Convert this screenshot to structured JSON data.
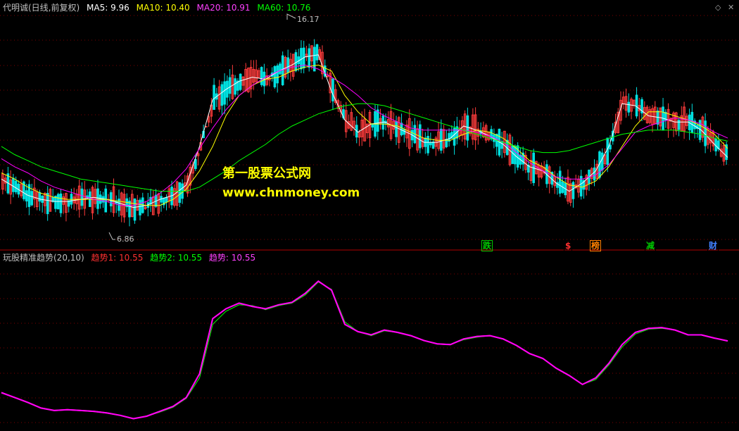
{
  "header": {
    "title": "代明诚(日线,前复权)",
    "ma5_label": "MA5: 9.96",
    "ma10_label": "MA10: 10.40",
    "ma20_label": "MA20: 10.91",
    "ma60_label": "MA60: 10.76",
    "icon": "diamond-icon"
  },
  "indicator_header": {
    "title": "玩股精准趋势(20,10)",
    "trend1_label": "趋势1: 10.55",
    "trend2_label": "趋势2: 10.55",
    "trend_label": "趋势: 10.55"
  },
  "watermark": {
    "line1": "第一股票公式网",
    "line2": "www.chnmoney.com"
  },
  "annotations": {
    "high": "16.17",
    "low": "6.86"
  },
  "events": [
    {
      "label": "跌",
      "color": "#00c800",
      "border": "#00c800"
    },
    {
      "label": "$",
      "color": "#ff3030",
      "border": "#000000"
    },
    {
      "label": "榜",
      "color": "#ff8000",
      "border": "#ff8000"
    },
    {
      "label": "减",
      "color": "#00c800",
      "border": "#000000"
    },
    {
      "label": "财",
      "color": "#4080ff",
      "border": "#000000"
    }
  ],
  "colors": {
    "up": "#ff3c3c",
    "down": "#00e0e0",
    "ma5": "#ffffff",
    "ma10": "#ffff00",
    "ma20": "#ff00ff",
    "ma60": "#00ff00",
    "trend1": "#ff3030",
    "trend2": "#00ff00",
    "trend": "#ff00ff",
    "grid": "#800000"
  },
  "chart_data": [
    {
      "type": "candlestick",
      "title": "代明诚(日线,前复权)",
      "price_range": [
        6.0,
        17.0
      ],
      "annotations": [
        {
          "label": "16.17",
          "value": 16.17
        },
        {
          "label": "6.86",
          "value": 6.86
        }
      ],
      "series": [
        {
          "name": "MA5",
          "values": [
            8.9,
            8.5,
            8.1,
            7.9,
            7.8,
            7.8,
            7.9,
            8.0,
            7.9,
            7.7,
            7.5,
            7.6,
            7.9,
            8.1,
            8.6,
            10.5,
            12.8,
            13.3,
            13.7,
            13.9,
            13.8,
            14.2,
            14.5,
            14.9,
            15.0,
            13.2,
            11.8,
            11.2,
            11.6,
            11.7,
            11.4,
            11.1,
            10.7,
            10.7,
            10.9,
            11.5,
            11.3,
            11.0,
            10.6,
            10.0,
            9.5,
            9.3,
            8.7,
            8.3,
            8.7,
            9.3,
            10.5,
            12.6,
            12.5,
            12.0,
            11.9,
            11.7,
            11.7,
            11.3,
            10.6,
            9.96
          ]
        },
        {
          "name": "MA10",
          "values": [
            9.2,
            8.9,
            8.5,
            8.2,
            8.0,
            7.9,
            7.9,
            7.9,
            7.9,
            7.8,
            7.7,
            7.6,
            7.6,
            7.9,
            8.4,
            9.3,
            10.5,
            12.0,
            13.0,
            13.5,
            13.8,
            13.9,
            14.2,
            14.4,
            14.5,
            14.2,
            13.0,
            12.2,
            11.6,
            11.6,
            11.5,
            11.2,
            10.9,
            10.8,
            10.8,
            11.1,
            11.3,
            11.2,
            10.9,
            10.4,
            9.8,
            9.5,
            9.0,
            8.6,
            8.5,
            8.8,
            9.5,
            10.5,
            11.5,
            12.2,
            12.2,
            12.0,
            11.8,
            11.5,
            11.1,
            10.4
          ]
        },
        {
          "name": "MA20",
          "values": [
            9.9,
            9.5,
            9.2,
            8.8,
            8.5,
            8.3,
            8.1,
            7.9,
            7.8,
            7.6,
            7.6,
            7.8,
            8.2,
            8.7,
            9.4,
            10.4,
            11.4,
            12.3,
            13.0,
            13.5,
            13.9,
            14.2,
            14.4,
            14.5,
            14.3,
            13.9,
            13.5,
            13.0,
            12.4,
            12.0,
            11.7,
            11.4,
            11.3,
            11.3,
            11.3,
            11.3,
            11.2,
            11.0,
            10.7,
            10.2,
            9.7,
            9.3,
            9.0,
            8.9,
            8.9,
            9.1,
            9.6,
            10.4,
            11.2,
            11.5,
            11.7,
            11.9,
            11.8,
            11.6,
            11.2,
            10.91
          ]
        },
        {
          "name": "MA60",
          "values": [
            10.5,
            10.1,
            9.8,
            9.5,
            9.3,
            9.1,
            8.9,
            8.8,
            8.7,
            8.6,
            8.5,
            8.4,
            8.3,
            8.3,
            8.3,
            8.5,
            8.9,
            9.3,
            9.8,
            10.2,
            10.6,
            11.1,
            11.5,
            11.8,
            12.1,
            12.3,
            12.5,
            12.6,
            12.6,
            12.5,
            12.3,
            12.1,
            11.9,
            11.7,
            11.5,
            11.3,
            11.1,
            10.9,
            10.7,
            10.5,
            10.3,
            10.2,
            10.2,
            10.3,
            10.5,
            10.7,
            10.9,
            11.1,
            11.2,
            11.3,
            11.3,
            11.3,
            11.2,
            11.1,
            10.9,
            10.76
          ]
        }
      ]
    },
    {
      "type": "line",
      "title": "玩股精准趋势(20,10)",
      "ylim": [
        0,
        20
      ],
      "series": [
        {
          "name": "趋势1",
          "values": [
            4.2,
            3.6,
            3.0,
            2.3,
            2.0,
            2.1,
            2.0,
            1.9,
            1.7,
            1.4,
            1.0,
            1.3,
            1.9,
            2.5,
            3.6,
            6.5,
            13.3,
            14.5,
            15.2,
            14.8,
            14.5,
            15.0,
            15.3,
            16.4,
            17.9,
            16.8,
            12.6,
            11.7,
            11.3,
            11.9,
            11.6,
            11.2,
            10.6,
            10.2,
            10.1,
            10.8,
            11.1,
            11.2,
            10.8,
            10.0,
            9.0,
            8.4,
            7.2,
            6.3,
            5.2,
            6.0,
            7.8,
            10.1,
            11.6,
            12.1,
            12.2,
            11.9,
            11.3,
            11.3,
            10.9,
            10.55
          ]
        },
        {
          "name": "趋势2",
          "values": [
            4.2,
            3.6,
            3.0,
            2.3,
            2.0,
            2.1,
            2.0,
            1.9,
            1.7,
            1.4,
            1.0,
            1.3,
            1.8,
            2.4,
            3.5,
            6.0,
            12.6,
            14.2,
            15.0,
            14.9,
            14.4,
            14.9,
            15.2,
            16.2,
            17.8,
            16.9,
            12.9,
            11.7,
            11.2,
            11.8,
            11.6,
            11.2,
            10.6,
            10.2,
            10.1,
            10.7,
            11.0,
            11.2,
            10.8,
            10.0,
            9.0,
            8.4,
            7.2,
            6.3,
            5.2,
            5.8,
            7.6,
            9.8,
            11.4,
            12.0,
            12.1,
            11.9,
            11.3,
            11.3,
            10.9,
            10.55
          ]
        },
        {
          "name": "趋势",
          "values": [
            4.2,
            3.6,
            3.0,
            2.3,
            2.0,
            2.1,
            2.0,
            1.9,
            1.7,
            1.4,
            1.0,
            1.3,
            1.9,
            2.5,
            3.6,
            6.5,
            13.3,
            14.5,
            15.2,
            14.8,
            14.5,
            15.0,
            15.3,
            16.4,
            17.9,
            16.8,
            12.6,
            11.7,
            11.3,
            11.9,
            11.6,
            11.2,
            10.6,
            10.2,
            10.1,
            10.8,
            11.1,
            11.2,
            10.8,
            10.0,
            9.0,
            8.4,
            7.2,
            6.3,
            5.2,
            6.0,
            7.8,
            10.1,
            11.6,
            12.1,
            12.2,
            11.9,
            11.3,
            11.3,
            10.9,
            10.55
          ]
        }
      ]
    }
  ]
}
